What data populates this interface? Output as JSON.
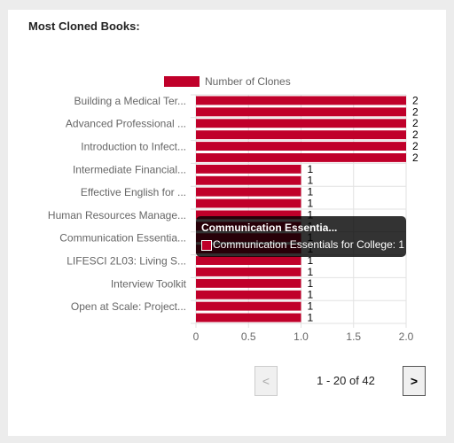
{
  "card": {
    "title": "Most Cloned Books:"
  },
  "chart_data": {
    "type": "bar",
    "orientation": "horizontal",
    "title": "",
    "legend": {
      "label": "Number of Clones",
      "position": "top",
      "color": "#c0002a"
    },
    "category_labels": [
      "Building a Medical Ter...",
      "Advanced Professional ...",
      "Introduction to Infect...",
      "Intermediate Financial...",
      "Effective English for ...",
      "Human Resources Manage...",
      "Communication Essentia...",
      "LIFESCI 2L03: Living S...",
      "Interview Toolkit",
      "Open at Scale: Project..."
    ],
    "values": [
      2,
      2,
      2,
      2,
      2,
      2,
      1,
      1,
      1,
      1,
      1,
      1,
      1,
      1,
      1,
      1,
      1,
      1,
      1,
      1
    ],
    "xlim": [
      0,
      2.0
    ],
    "x_ticks": [
      "0",
      "0.5",
      "1.0",
      "1.5",
      "2.0"
    ],
    "x_tick_values": [
      0,
      0.5,
      1.0,
      1.5,
      2.0
    ],
    "grid": true,
    "bar_color": "#c0002a"
  },
  "tooltip": {
    "title": "Communication Essentia...",
    "body": "Communication Essentials for College: 1"
  },
  "pagination": {
    "prev_label": "<",
    "next_label": ">",
    "info": "1 - 20 of 42"
  }
}
